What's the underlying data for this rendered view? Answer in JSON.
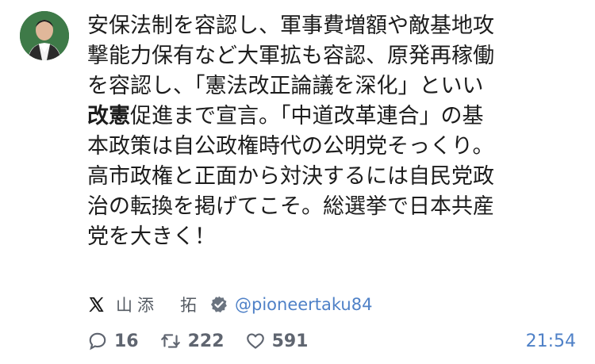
{
  "post": {
    "lines": [
      {
        "parts": [
          {
            "text": "安保法制を容認し、軍事費増額や敵基地攻",
            "bold": false
          }
        ]
      },
      {
        "parts": [
          {
            "text": "撃能力保有など大軍拡も容認、原発再稼働",
            "bold": false
          }
        ]
      },
      {
        "parts": [
          {
            "text": "を容認し、「憲法改正論議を深化」といい",
            "bold": false
          }
        ]
      },
      {
        "parts": [
          {
            "text": "改憲",
            "bold": true
          },
          {
            "text": "促進まで宣言。「中道改革連合」の基",
            "bold": false
          }
        ]
      },
      {
        "parts": [
          {
            "text": "本政策は自公政権時代の公明党そっくり。",
            "bold": false
          }
        ]
      },
      {
        "parts": [
          {
            "text": "高市政権と正面から対決するには自民党政",
            "bold": false
          }
        ]
      },
      {
        "parts": [
          {
            "text": "治の転換を掲げてこそ。総選挙で日本共産",
            "bold": false
          }
        ]
      },
      {
        "parts": [
          {
            "text": "党を大きく！",
            "bold": false
          }
        ]
      }
    ]
  },
  "author": {
    "name": "山添　拓",
    "handle": "@pioneertaku84",
    "verified": true,
    "platform_icon": "x-logo-icon"
  },
  "stats": {
    "replies": "16",
    "reposts": "222",
    "likes": "591",
    "time": "21:54"
  },
  "colors": {
    "text": "#1c1c1c",
    "muted": "#5f6570",
    "link": "#4f81c7"
  }
}
